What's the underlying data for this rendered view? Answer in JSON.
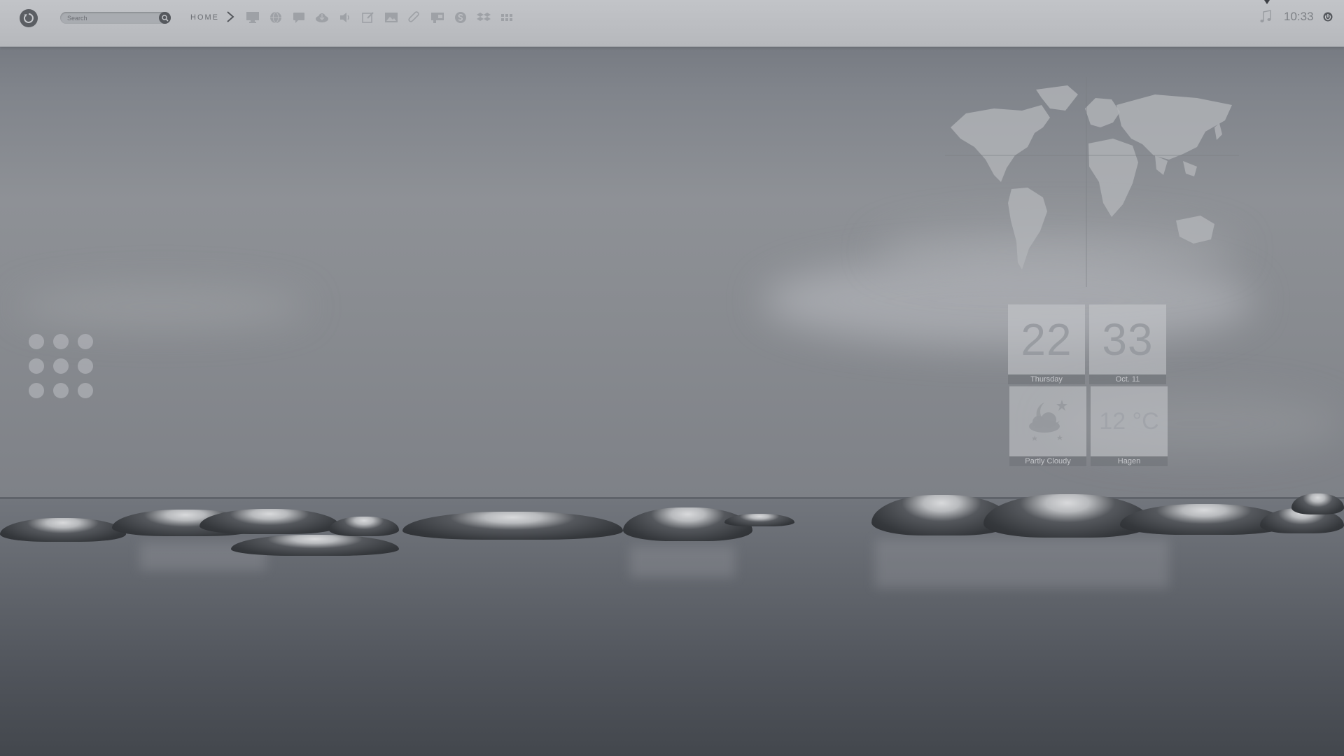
{
  "topbar": {
    "search": {
      "placeholder": "Search"
    },
    "home_label": "HOME",
    "toolbar_icons": [
      "monitor-icon",
      "globe-icon",
      "chat-icon",
      "cloud-icon",
      "speaker-icon",
      "edit-icon",
      "image-icon",
      "paperclip-icon",
      "presentation-icon",
      "skype-icon",
      "dropbox-icon",
      "grid-icon"
    ],
    "clock": "10:33"
  },
  "widgets": {
    "time_tiles": {
      "hour": "22",
      "minute": "33",
      "day": "Thursday",
      "date": "Oct. 11"
    },
    "weather": {
      "condition": "Partly Cloudy",
      "temperature": "12 °C",
      "location": "Hagen"
    }
  },
  "colors": {
    "topbar": "#bdbfc3",
    "sky": "#888b90",
    "water": "#55595f",
    "tile": "#c8cace"
  }
}
